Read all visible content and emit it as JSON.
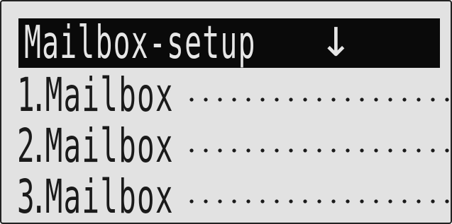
{
  "header": {
    "title": "Mailbox-setup",
    "arrow_icon": "arrow-down-icon",
    "arrow_glyph": "↓"
  },
  "menu": {
    "items": [
      {
        "number": "1.",
        "label": "Mailbox"
      },
      {
        "number": "2.",
        "label": "Mailbox"
      },
      {
        "number": "3.",
        "label": "Mailbox"
      }
    ]
  },
  "colors": {
    "screen_bg": "#e2e2e2",
    "text": "#1a1a1a",
    "header_bg": "#0a0a0a",
    "header_text": "#e6e6e6"
  }
}
